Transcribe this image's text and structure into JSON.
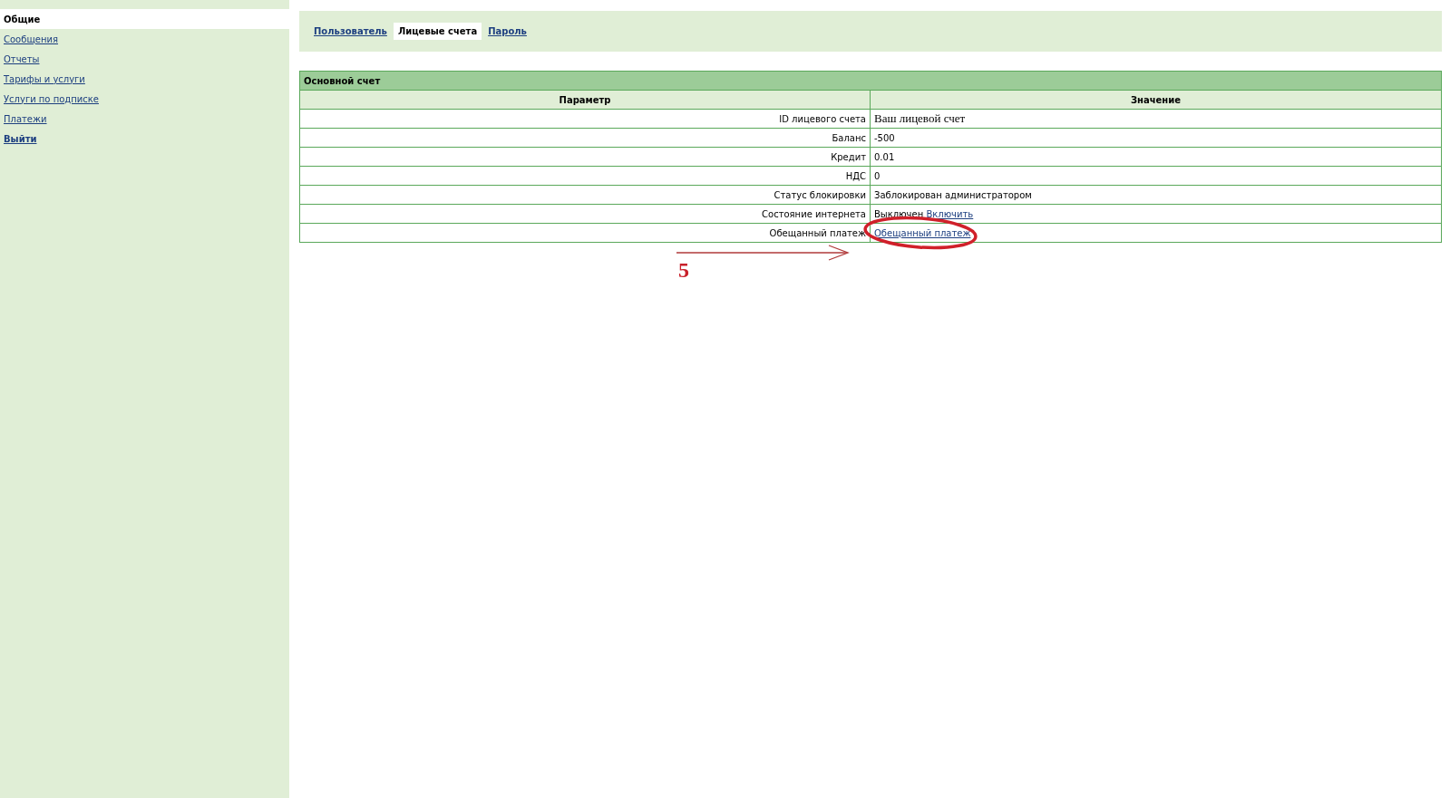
{
  "sidebar": {
    "items": [
      {
        "label": "Общие",
        "selected": true,
        "kind": "section"
      },
      {
        "label": "Сообщения",
        "selected": false,
        "kind": "link"
      },
      {
        "label": "Отчеты",
        "selected": false,
        "kind": "link"
      },
      {
        "label": "Тарифы и услуги",
        "selected": false,
        "kind": "link"
      },
      {
        "label": "Услуги по подписке",
        "selected": false,
        "kind": "link"
      },
      {
        "label": "Платежи",
        "selected": false,
        "kind": "link"
      },
      {
        "label": "Выйти",
        "selected": false,
        "kind": "logout"
      }
    ]
  },
  "tabs": [
    {
      "label": "Пользователь",
      "selected": false
    },
    {
      "label": "Лицевые счета",
      "selected": true
    },
    {
      "label": "Пароль",
      "selected": false
    }
  ],
  "table": {
    "title": "Основной счет",
    "columns": [
      "Параметр",
      "Значение"
    ],
    "rows": [
      {
        "parameter": "ID лицевого счета",
        "value": [
          {
            "kind": "large",
            "text": "Ваш лицевой счет"
          }
        ]
      },
      {
        "parameter": "Баланс",
        "value": [
          {
            "kind": "plain",
            "text": "-500"
          }
        ]
      },
      {
        "parameter": "Кредит",
        "value": [
          {
            "kind": "plain",
            "text": "0.01"
          }
        ]
      },
      {
        "parameter": "НДС",
        "value": [
          {
            "kind": "plain",
            "text": "0"
          }
        ]
      },
      {
        "parameter": "Статус блокировки",
        "value": [
          {
            "kind": "plain",
            "text": "Заблокирован администратором"
          }
        ]
      },
      {
        "parameter": "Состояние интернета",
        "value": [
          {
            "kind": "plain",
            "text": "Выключен"
          },
          {
            "kind": "link",
            "text": "Включить"
          }
        ]
      },
      {
        "parameter": "Обещанный платеж",
        "value": [
          {
            "kind": "link",
            "text": "Обещанный платеж"
          }
        ]
      }
    ]
  },
  "annotation": {
    "label": "5"
  }
}
